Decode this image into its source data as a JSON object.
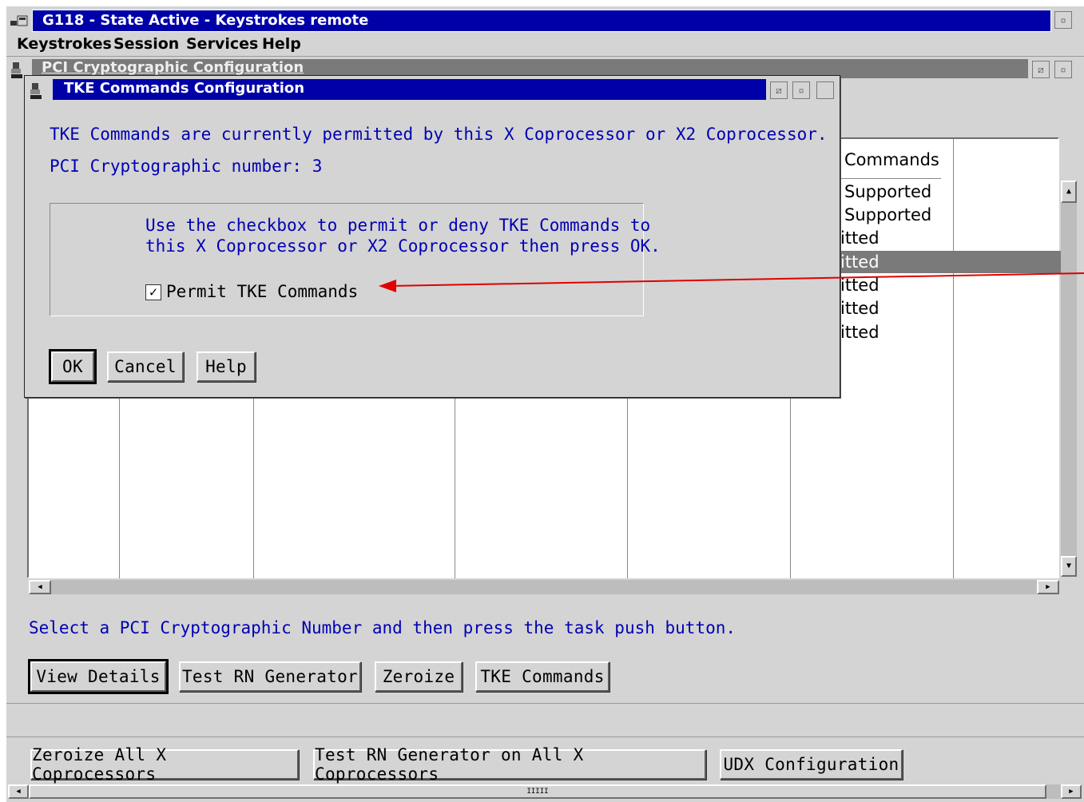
{
  "main_window": {
    "title": "G118 - State Active - Keystrokes remote",
    "menu": [
      "Keystrokes",
      "Session",
      "Services",
      "Help"
    ]
  },
  "pci_window": {
    "title": "PCI Cryptographic Configuration",
    "table": {
      "visible_header": "Commands",
      "rows": [
        "Supported",
        "Supported",
        "itted",
        "itted",
        "itted",
        "itted",
        "itted"
      ],
      "selected_row_index": 3
    },
    "instruction": "Select a PCI Cryptographic Number and then press the task push button.",
    "task_buttons": [
      "View Details",
      "Test RN Generator",
      "Zeroize",
      "TKE Commands"
    ],
    "bottom_buttons": [
      "Zeroize All X Coprocessors",
      "Test RN Generator on All X Coprocessors",
      "UDX Configuration"
    ]
  },
  "dialog": {
    "title": "TKE Commands Configuration",
    "status_line": "TKE Commands are currently permitted by this X Coprocessor or X2 Coprocessor.",
    "number_line": "PCI Cryptographic number: 3",
    "instructions_line1": "Use the checkbox to permit or deny TKE Commands to",
    "instructions_line2": "this X Coprocessor or X2 Coprocessor then press OK.",
    "checkbox_label": "Permit TKE Commands",
    "checkbox_checked": true,
    "buttons": [
      "OK",
      "Cancel",
      "Help"
    ]
  },
  "colors": {
    "active_title": "#0000a8",
    "inactive_title": "#7a7a7a",
    "text_blue": "#0000b4",
    "annotation_arrow": "#e00000",
    "selected_row": "#7a7a7a"
  }
}
